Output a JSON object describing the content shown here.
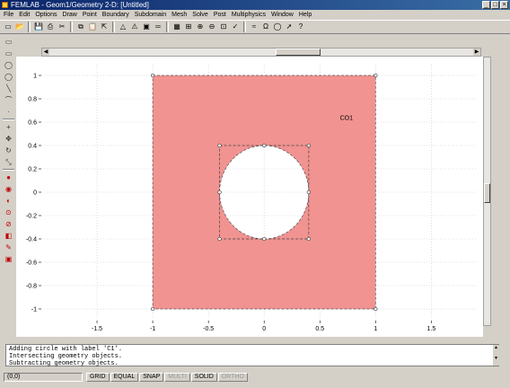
{
  "window": {
    "title": "FEMLAB - Geom1/Geometry 2-D: [Untitled]",
    "controls": [
      "_",
      "□",
      "×"
    ]
  },
  "menu": [
    "File",
    "Edit",
    "Options",
    "Draw",
    "Point",
    "Boundary",
    "Subdomain",
    "Mesh",
    "Solve",
    "Post",
    "Multiphysics",
    "Window",
    "Help"
  ],
  "toolbar": {
    "icons": [
      "new-icon",
      "open-icon",
      "save-icon",
      "print-icon",
      "cut-icon",
      "copy-icon",
      "paste-icon",
      "pointer-icon",
      "triangle-icon",
      "warning-icon",
      "subdomain-icon",
      "equals-icon",
      "mesh-icon",
      "refine-icon",
      "zoom-in-icon",
      "zoom-out-icon",
      "zoom-window-icon",
      "plot-icon",
      "solve-icon",
      "omega-icon",
      "circle-icon",
      "arrow-icon",
      "help-icon"
    ],
    "glyphs": [
      "▭",
      "📂",
      "💾",
      "⎙",
      "✂",
      "⧉",
      "📋",
      "⇱",
      "△",
      "⚠",
      "▣",
      "═",
      "▦",
      "⊞",
      "⊕",
      "⊖",
      "⊡",
      "✓",
      "≈",
      "Ω",
      "◯",
      "➚",
      "?"
    ]
  },
  "left_tools": {
    "icons": [
      "rectangle-icon",
      "rectangle-centered-icon",
      "ellipse-icon",
      "ellipse-centered-icon",
      "line-icon",
      "curve-icon",
      "point-icon",
      "union-icon",
      "move-icon",
      "rotate-icon",
      "scale-icon",
      "solid-icon",
      "intersect-icon",
      "difference-icon",
      "compose-icon",
      "split-icon",
      "coerce-icon",
      "pencil-icon",
      "delete-icon"
    ],
    "glyphs": [
      "▭",
      "▭",
      "◯",
      "◯",
      "╲",
      "⌒",
      "·",
      "+",
      "✥",
      "↻",
      "⤡",
      "●",
      "◉",
      "◐",
      "⊙",
      "⊘",
      "◧",
      "✎",
      "▣"
    ]
  },
  "chart_data": {
    "type": "geometry",
    "xlim": [
      -2,
      1.9
    ],
    "ylim": [
      -1.1,
      1.1
    ],
    "xticks": [
      -1.5,
      -1,
      -0.5,
      0,
      0.5,
      1,
      1.5
    ],
    "yticks": [
      -1,
      -0.8,
      -0.6,
      -0.4,
      -0.2,
      0,
      0.2,
      0.4,
      0.6,
      0.8,
      1
    ],
    "grid": true,
    "square": {
      "xmin": -1,
      "xmax": 1,
      "ymin": -1,
      "ymax": 1,
      "color": "#f19391"
    },
    "hole": {
      "cx": 0,
      "cy": 0,
      "r": 0.4
    },
    "hole_box": {
      "xmin": -0.4,
      "xmax": 0.4,
      "ymin": -0.4,
      "ymax": 0.4
    },
    "label": {
      "text": "CO1",
      "x": 0.68,
      "y": 0.62
    }
  },
  "messages": [
    "Adding circle with label 'C1'.",
    "Intersecting geometry objects.",
    "Subtracting geometry objects."
  ],
  "status": {
    "coords": "(0,0)",
    "buttons": [
      {
        "label": "GRID",
        "enabled": true
      },
      {
        "label": "EQUAL",
        "enabled": true
      },
      {
        "label": "SNAP",
        "enabled": true
      },
      {
        "label": "MULTI",
        "enabled": false
      },
      {
        "label": "SOLID",
        "enabled": true
      },
      {
        "label": "ORTHO",
        "enabled": false
      }
    ]
  }
}
